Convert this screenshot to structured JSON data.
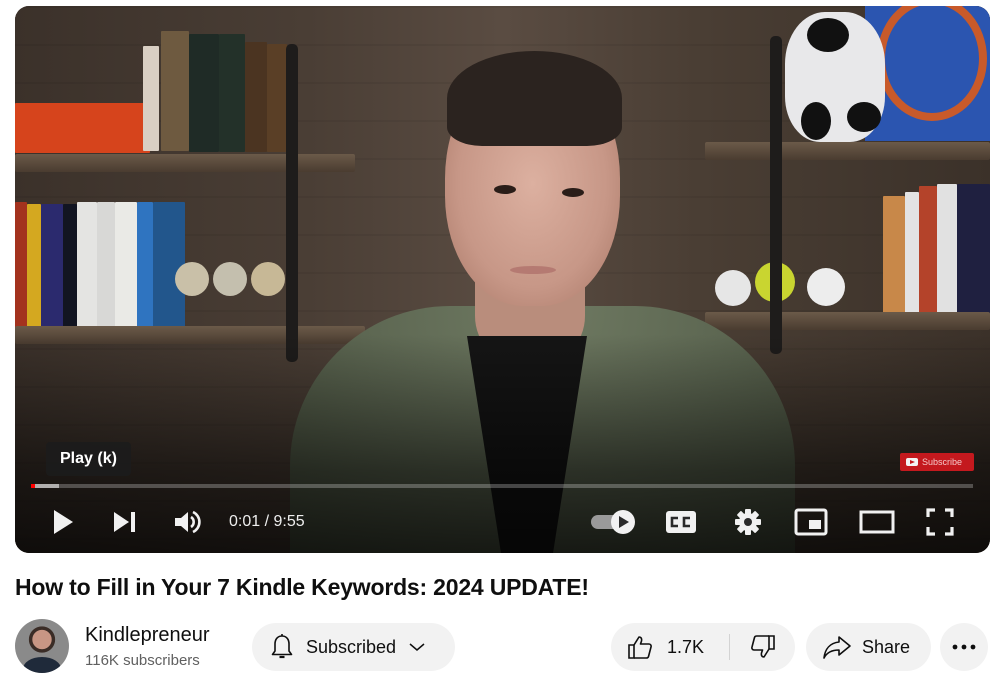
{
  "player": {
    "tooltip": "Play (k)",
    "current_time": "0:01",
    "time_separator": " / ",
    "duration": "9:55",
    "time_display": "0:01 / 9:55",
    "progress_played_fraction": 0.002,
    "progress_loaded_fraction": 0.03,
    "autoplay_on": true,
    "subscribe_watermark": "Subscribe",
    "controls": {
      "play": "play-icon",
      "next": "next-icon",
      "volume": "volume-icon",
      "autoplay": "autoplay-toggle-icon",
      "captions": "captions-icon",
      "settings": "gear-icon",
      "miniplayer": "miniplayer-icon",
      "theater": "theater-mode-icon",
      "fullscreen": "fullscreen-icon"
    }
  },
  "video": {
    "title": "How to Fill in Your 7 Kindle Keywords: 2024 UPDATE!"
  },
  "channel": {
    "name": "Kindlepreneur",
    "subscribers": "116K subscribers",
    "subscribe_state": "Subscribed"
  },
  "actions": {
    "likes": "1.7K",
    "share": "Share",
    "more": "more-actions-icon"
  },
  "colors": {
    "progress_played": "#ff0000",
    "watermark_bg": "#c4191e",
    "pill_bg": "#f2f2f2",
    "secondary_text": "#606060"
  }
}
